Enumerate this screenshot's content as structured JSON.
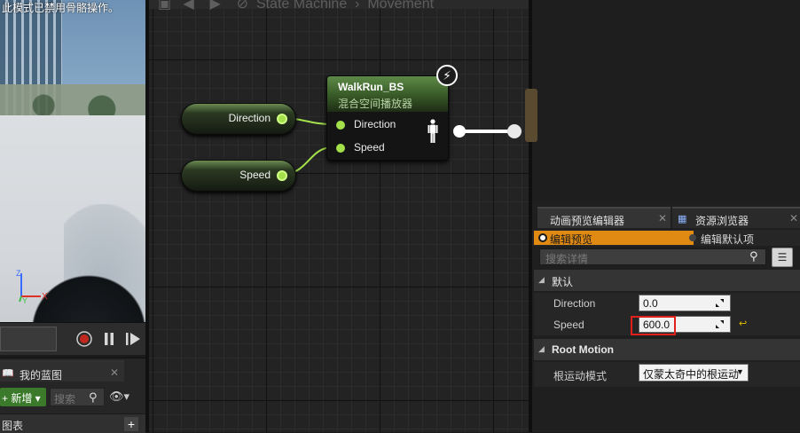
{
  "viewport": {
    "note": "此模式已禁用骨骼操作。",
    "axis_x": "X",
    "axis_y": "Y",
    "axis_z": "Z"
  },
  "blueprint_panel": {
    "tab_label": "我的蓝图",
    "tab_close": "✕",
    "add_label": "+ 新增 ▾",
    "search_placeholder": "搜索",
    "graph_label": "图表"
  },
  "graph": {
    "breadcrumb": [
      "State Machine",
      "Movement"
    ],
    "pill_nodes": [
      {
        "label": "Direction"
      },
      {
        "label": "Speed"
      }
    ],
    "node": {
      "title": "WalkRun_BS",
      "subtitle": "混合空间播放器",
      "inputs": [
        "Direction",
        "Speed"
      ]
    }
  },
  "details_panel": {
    "tabs": [
      {
        "label": "动画预览编辑器",
        "active": true
      },
      {
        "label": "资源浏览器",
        "active": false
      }
    ],
    "mode_edit": "编辑预览",
    "mode_default": "编辑默认项",
    "search_placeholder": "搜索详情",
    "category_default": "默认",
    "properties": [
      {
        "label": "Direction",
        "value": "0.0"
      },
      {
        "label": "Speed",
        "value": "600.0"
      }
    ],
    "category_root_motion": "Root Motion",
    "root_motion": {
      "label": "根运动模式",
      "value": "仅蒙太奇中的根运动"
    }
  },
  "colors": {
    "accent": "#e08a14",
    "pin": "#a3e04a",
    "highlight": "#e0201b",
    "node_header": "#5d8a47"
  }
}
